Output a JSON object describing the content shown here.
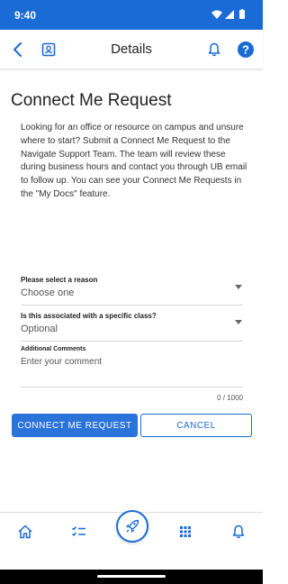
{
  "status_bar": {
    "time": "9:40",
    "icons": [
      "wifi-icon",
      "signal-icon",
      "battery-icon"
    ]
  },
  "app_bar": {
    "title": "Details",
    "left_icons": [
      "back-arrow-icon",
      "contact-card-icon"
    ],
    "right_icons": [
      "bell-icon",
      "help-icon"
    ],
    "help_glyph": "?"
  },
  "page": {
    "title": "Connect Me Request",
    "intro": "Looking for an office or resource on campus and unsure where to start? Submit a Connect Me Request to the Navigate Support Team. The team will review these during business hours and contact you through UB email to follow up. You can see your Connect Me Requests in the \"My Docs\" feature."
  },
  "form": {
    "reason": {
      "label": "Please select a reason",
      "value": "Choose one"
    },
    "class": {
      "label": "Is this associated with a specific class?",
      "value": "Optional"
    },
    "comments": {
      "label": "Additional Comments",
      "placeholder": "Enter your comment",
      "counter": "0 / 1000"
    }
  },
  "actions": {
    "submit_label": "CONNECT ME REQUEST",
    "cancel_label": "CANCEL"
  },
  "bottom_nav": {
    "items": [
      "home-icon",
      "checklist-icon",
      "rocket-icon",
      "apps-grid-icon",
      "bell-icon"
    ]
  },
  "colors": {
    "accent": "#1a6bd6",
    "primary_button": "#2a73db",
    "text": "#222222"
  }
}
